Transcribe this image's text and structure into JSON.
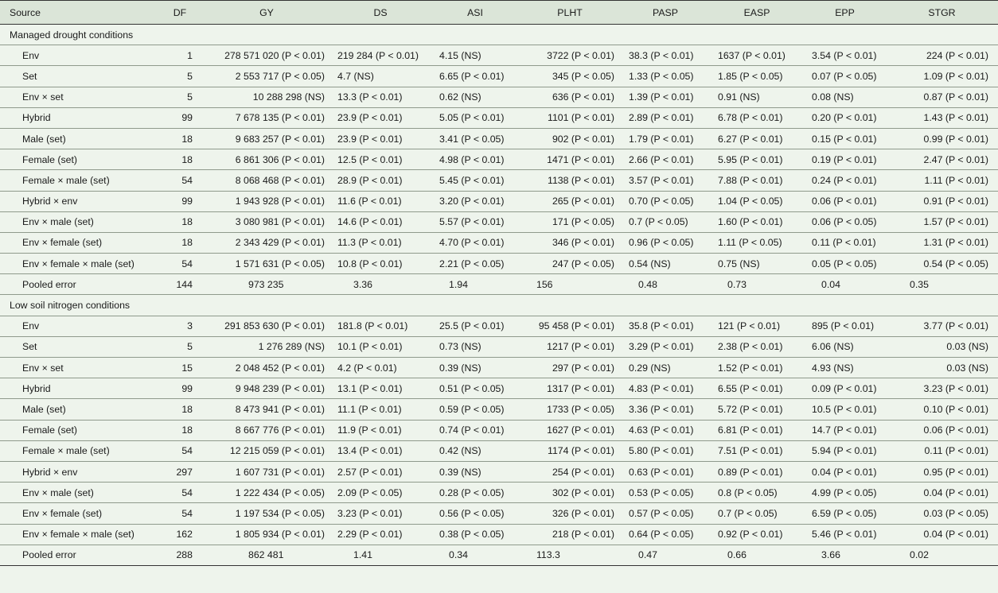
{
  "headers": [
    "Source",
    "DF",
    "GY",
    "DS",
    "ASI",
    "PLHT",
    "PASP",
    "EASP",
    "EPP",
    "STGR"
  ],
  "sections": [
    {
      "title": "Managed drought conditions",
      "rows": [
        [
          "Env",
          "1",
          "278 571 020 (P < 0.01)",
          "219 284 (P < 0.01)",
          "4.15 (NS)",
          "3722 (P < 0.01)",
          "38.3 (P < 0.01)",
          "1637 (P < 0.01)",
          "3.54 (P < 0.01)",
          "224 (P < 0.01)"
        ],
        [
          "Set",
          "5",
          "2 553 717 (P < 0.05)",
          "4.7 (NS)",
          "6.65 (P < 0.01)",
          "345 (P < 0.05)",
          "1.33 (P < 0.05)",
          "1.85 (P < 0.05)",
          "0.07 (P < 0.05)",
          "1.09 (P < 0.01)"
        ],
        [
          "Env × set",
          "5",
          "10 288 298 (NS)",
          "13.3 (P < 0.01)",
          "0.62 (NS)",
          "636 (P < 0.01)",
          "1.39 (P < 0.01)",
          "0.91 (NS)",
          "0.08 (NS)",
          "0.87 (P < 0.01)"
        ],
        [
          "Hybrid",
          "99",
          "7 678 135 (P < 0.01)",
          "23.9 (P < 0.01)",
          "5.05 (P < 0.01)",
          "1101 (P < 0.01)",
          "2.89 (P < 0.01)",
          "6.78 (P < 0.01)",
          "0.20 (P < 0.01)",
          "1.43 (P < 0.01)"
        ],
        [
          "Male (set)",
          "18",
          "9 683 257 (P < 0.01)",
          "23.9 (P < 0.01)",
          "3.41 (P < 0.05)",
          "902 (P < 0.01)",
          "1.79 (P < 0.01)",
          "6.27 (P < 0.01)",
          "0.15 (P < 0.01)",
          "0.99 (P < 0.01)"
        ],
        [
          "Female (set)",
          "18",
          "6 861 306 (P < 0.01)",
          "12.5 (P < 0.01)",
          "4.98 (P < 0.01)",
          "1471 (P < 0.01)",
          "2.66 (P < 0.01)",
          "5.95 (P < 0.01)",
          "0.19 (P < 0.01)",
          "2.47 (P < 0.01)"
        ],
        [
          "Female × male (set)",
          "54",
          "8 068 468 (P < 0.01)",
          "28.9 (P < 0.01)",
          "5.45 (P < 0.01)",
          "1138 (P < 0.01)",
          "3.57 (P < 0.01)",
          "7.88 (P < 0.01)",
          "0.24 (P < 0.01)",
          "1.11 (P < 0.01)"
        ],
        [
          "Hybrid × env",
          "99",
          "1 943 928 (P < 0.01)",
          "11.6 (P < 0.01)",
          "3.20 (P < 0.01)",
          "265 (P < 0.01)",
          "0.70 (P < 0.05)",
          "1.04 (P < 0.05)",
          "0.06 (P < 0.01)",
          "0.91 (P < 0.01)"
        ],
        [
          "Env × male (set)",
          "18",
          "3 080 981 (P < 0.01)",
          "14.6 (P < 0.01)",
          "5.57 (P < 0.01)",
          "171 (P < 0.05)",
          "0.7 (P < 0.05)",
          "1.60 (P < 0.01)",
          "0.06 (P < 0.05)",
          "1.57 (P < 0.01)"
        ],
        [
          "Env × female (set)",
          "18",
          "2 343 429 (P < 0.01)",
          "11.3 (P < 0.01)",
          "4.70 (P < 0.01)",
          "346 (P < 0.01)",
          "0.96 (P < 0.05)",
          "1.11 (P < 0.05)",
          "0.11 (P < 0.01)",
          "1.31 (P < 0.01)"
        ],
        [
          "Env × female × male (set)",
          "54",
          "1 571 631 (P < 0.05)",
          "10.8 (P < 0.01)",
          "2.21 (P < 0.05)",
          "247 (P < 0.05)",
          "0.54 (NS)",
          "0.75 (NS)",
          "0.05 (P < 0.05)",
          "0.54 (P < 0.05)"
        ]
      ],
      "pooled": [
        "Pooled error",
        "144",
        "973 235",
        "3.36",
        "1.94",
        "156",
        "0.48",
        "0.73",
        "0.04",
        "0.35"
      ]
    },
    {
      "title": "Low soil nitrogen conditions",
      "rows": [
        [
          "Env",
          "3",
          "291 853 630 (P < 0.01)",
          "181.8 (P < 0.01)",
          "25.5 (P < 0.01)",
          "95 458 (P < 0.01)",
          "35.8 (P < 0.01)",
          "121 (P < 0.01)",
          "895 (P < 0.01)",
          "3.77 (P < 0.01)"
        ],
        [
          "Set",
          "5",
          "1 276 289 (NS)",
          "10.1 (P < 0.01)",
          "0.73 (NS)",
          "1217 (P < 0.01)",
          "3.29 (P < 0.01)",
          "2.38 (P < 0.01)",
          "6.06 (NS)",
          "0.03 (NS)"
        ],
        [
          "Env × set",
          "15",
          "2 048 452 (P < 0.01)",
          "4.2 (P < 0.01)",
          "0.39 (NS)",
          "297 (P < 0.01)",
          "0.29 (NS)",
          "1.52 (P < 0.01)",
          "4.93 (NS)",
          "0.03 (NS)"
        ],
        [
          "Hybrid",
          "99",
          "9 948 239 (P < 0.01)",
          "13.1 (P < 0.01)",
          "0.51 (P < 0.05)",
          "1317 (P < 0.01)",
          "4.83 (P < 0.01)",
          "6.55 (P < 0.01)",
          "0.09 (P < 0.01)",
          "3.23 (P < 0.01)"
        ],
        [
          "Male (set)",
          "18",
          "8 473 941 (P < 0.01)",
          "11.1 (P < 0.01)",
          "0.59 (P < 0.05)",
          "1733 (P < 0.05)",
          "3.36 (P < 0.01)",
          "5.72 (P < 0.01)",
          "10.5 (P < 0.01)",
          "0.10 (P < 0.01)"
        ],
        [
          "Female (set)",
          "18",
          "8 667 776 (P < 0.01)",
          "11.9 (P < 0.01)",
          "0.74 (P < 0.01)",
          "1627 (P < 0.01)",
          "4.63 (P < 0.01)",
          "6.81 (P < 0.01)",
          "14.7 (P < 0.01)",
          "0.06 (P < 0.01)"
        ],
        [
          "Female × male (set)",
          "54",
          "12 215 059 (P < 0.01)",
          "13.4 (P < 0.01)",
          "0.42 (NS)",
          "1174 (P < 0.01)",
          "5.80 (P < 0.01)",
          "7.51 (P < 0.01)",
          "5.94 (P < 0.01)",
          "0.11 (P < 0.01)"
        ],
        [
          "Hybrid × env",
          "297",
          "1 607 731 (P < 0.01)",
          "2.57 (P < 0.01)",
          "0.39 (NS)",
          "254 (P < 0.01)",
          "0.63 (P < 0.01)",
          "0.89 (P < 0.01)",
          "0.04 (P < 0.01)",
          "0.95 (P < 0.01)"
        ],
        [
          "Env × male (set)",
          "54",
          "1 222 434 (P < 0.05)",
          "2.09 (P < 0.05)",
          "0.28 (P < 0.05)",
          "302 (P < 0.01)",
          "0.53 (P < 0.05)",
          "0.8 (P < 0.05)",
          "4.99 (P < 0.05)",
          "0.04 (P < 0.01)"
        ],
        [
          "Env × female (set)",
          "54",
          "1 197 534 (P < 0.05)",
          "3.23 (P < 0.01)",
          "0.56 (P < 0.05)",
          "326 (P < 0.01)",
          "0.57 (P < 0.05)",
          "0.7 (P < 0.05)",
          "6.59 (P < 0.05)",
          "0.03 (P < 0.05)"
        ],
        [
          "Env × female × male (set)",
          "162",
          "1 805 934 (P < 0.01)",
          "2.29 (P < 0.01)",
          "0.38 (P < 0.05)",
          "218 (P < 0.01)",
          "0.64 (P < 0.05)",
          "0.92 (P < 0.01)",
          "5.46 (P < 0.01)",
          "0.04 (P < 0.01)"
        ]
      ],
      "pooled": [
        "Pooled error",
        "288",
        "862 481",
        "1.41",
        "0.34",
        "113.3",
        "0.47",
        "0.66",
        "3.66",
        "0.02"
      ]
    }
  ]
}
